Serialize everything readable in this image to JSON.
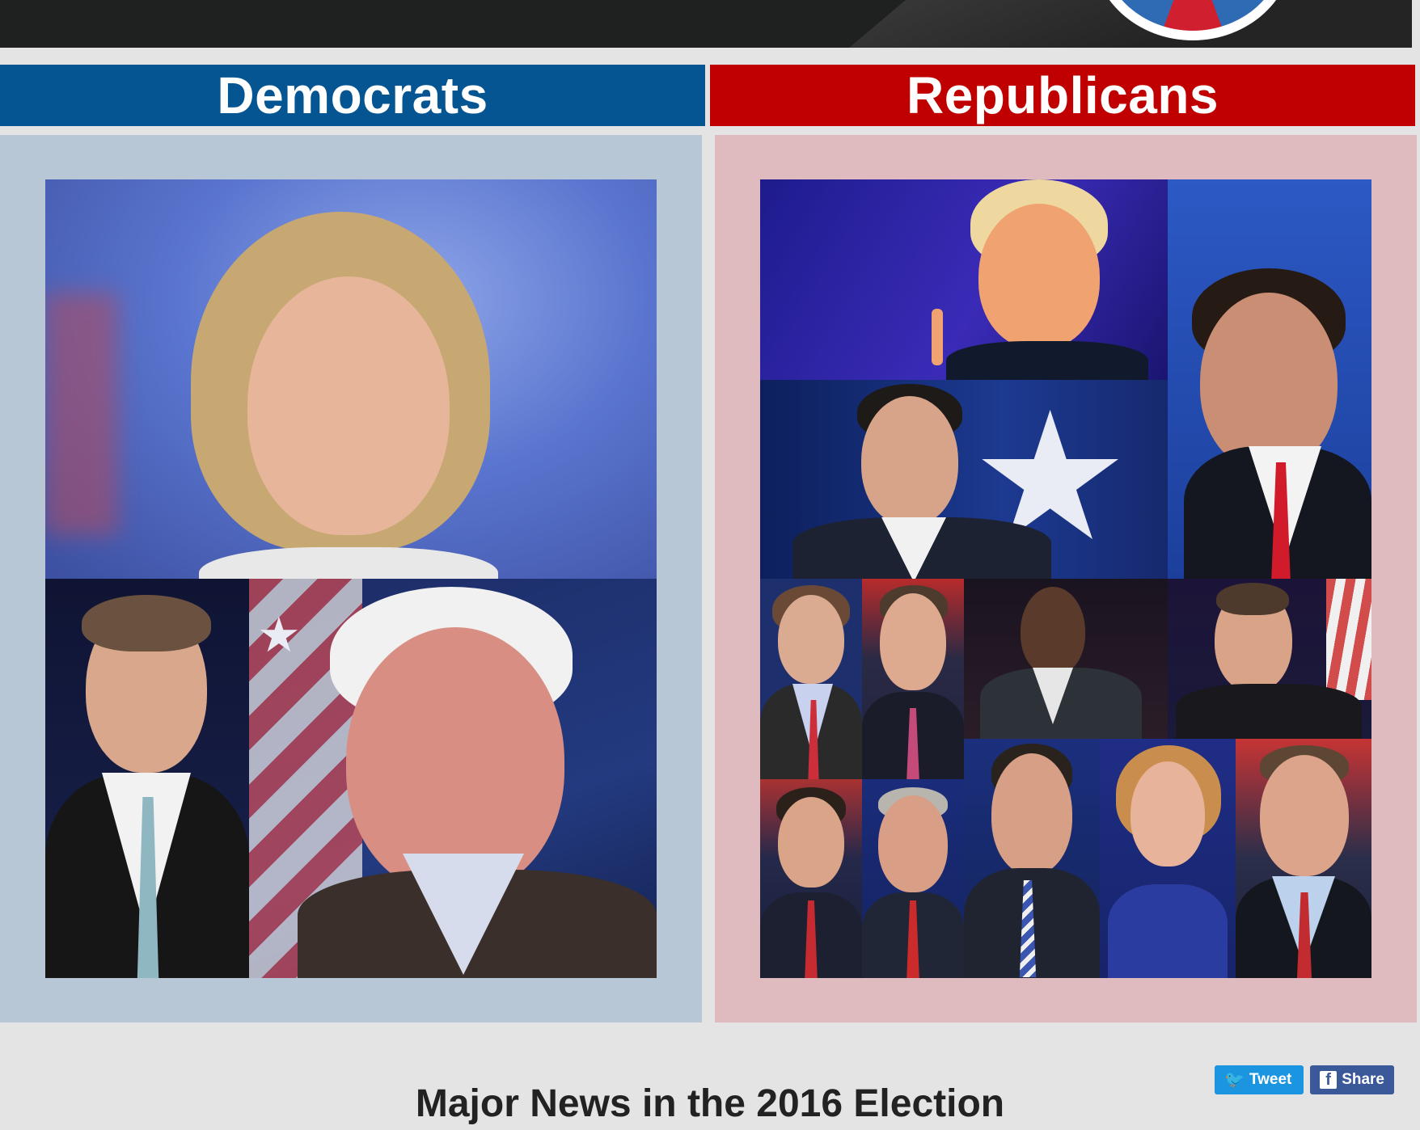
{
  "header": {
    "logo": "campaign-logo"
  },
  "parties": {
    "democrats": {
      "label": "Democrats",
      "band_color": "#045591",
      "panel_color": "#b7c7d6"
    },
    "republicans": {
      "label": "Republicans",
      "band_color": "#c00000",
      "panel_color": "#dfbbc0"
    }
  },
  "democrat_photos": [
    "candidate-photo-1",
    "candidate-photo-2",
    "candidate-photo-3"
  ],
  "republican_photos": [
    "candidate-photo-1",
    "candidate-photo-2",
    "candidate-photo-3",
    "candidate-photo-4",
    "candidate-photo-5",
    "candidate-photo-6",
    "candidate-photo-7",
    "candidate-photo-8",
    "candidate-photo-9",
    "candidate-photo-10",
    "candidate-photo-11",
    "candidate-photo-12",
    "candidate-photo-13"
  ],
  "news": {
    "title": "Major News in the 2016 Election"
  },
  "share": {
    "tweet_label": "Tweet",
    "share_label": "Share",
    "tweet_icon": "twitter-bird-icon",
    "share_icon": "facebook-f-icon"
  }
}
